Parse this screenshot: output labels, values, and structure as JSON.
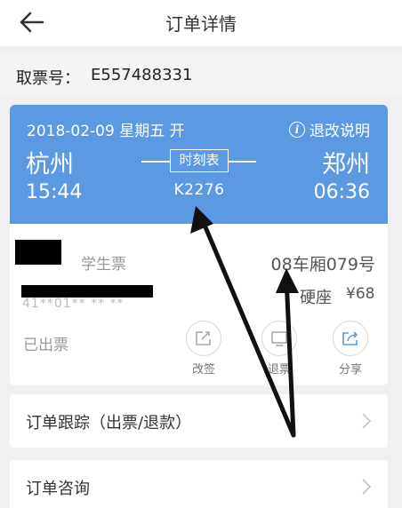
{
  "nav": {
    "title": "订单详情",
    "back_icon": "back-arrow-icon"
  },
  "ticket": {
    "label": "取票号：",
    "number": "E557488331"
  },
  "trip": {
    "date": "2018-02-09 星期五 开",
    "rule_label": "退改说明",
    "from_city": "杭州",
    "to_city": "郑州",
    "depart_time": "15:44",
    "arrive_time": "06:36",
    "schedule_label": "时刻表",
    "train_no": "K2276",
    "header_color": "#5b9ae3"
  },
  "passenger": {
    "ticket_type": "学生票",
    "seat_no": "08车厢079号",
    "seat_class": "硬座",
    "price": "¥68",
    "status": "已出票",
    "id_fragment": "41**01**  **   **"
  },
  "actions": [
    {
      "label": "改签",
      "icon": "reschedule-icon"
    },
    {
      "label": "退票",
      "icon": "refund-icon"
    },
    {
      "label": "分享",
      "icon": "share-icon"
    }
  ],
  "rows": [
    {
      "label": "订单跟踪（出票/退款）"
    },
    {
      "label": "订单咨询"
    }
  ]
}
